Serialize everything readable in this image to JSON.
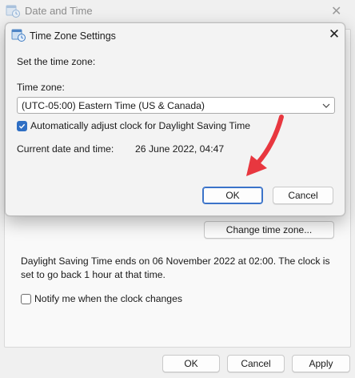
{
  "parent_window": {
    "title": "Date and Time",
    "change_zone_button": "Change time zone...",
    "dst_notice": "Daylight Saving Time ends on 06 November 2022 at 02:00. The clock is set to go back 1 hour at that time.",
    "notify_label": "Notify me when the clock changes",
    "notify_checked": false,
    "ok_label": "OK",
    "cancel_label": "Cancel",
    "apply_label": "Apply"
  },
  "dialog": {
    "title": "Time Zone Settings",
    "heading": "Set the time zone:",
    "timezone_label": "Time zone:",
    "timezone_value": "(UTC-05:00) Eastern Time (US & Canada)",
    "auto_dst_label": "Automatically adjust clock for Daylight Saving Time",
    "auto_dst_checked": true,
    "current_label": "Current date and time:",
    "current_value": "26 June 2022, 04:47",
    "ok_label": "OK",
    "cancel_label": "Cancel"
  },
  "colors": {
    "accent": "#2f6fc4",
    "annotation_arrow": "#e8373f"
  },
  "icons": {
    "app": "date-time-globe-icon",
    "close": "close-icon",
    "dropdown": "chevron-down-icon",
    "check": "checkmark-icon"
  }
}
